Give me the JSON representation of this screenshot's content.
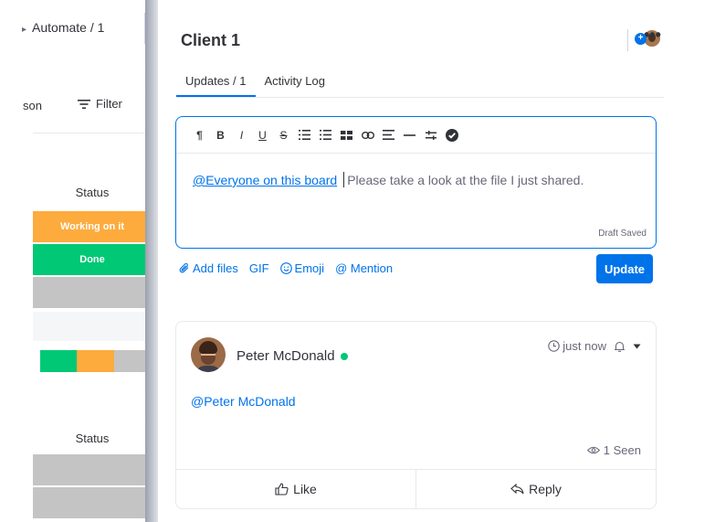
{
  "board": {
    "automate_label": "Automate / 1",
    "person_label": "son",
    "filter_label": "Filter",
    "status_header_1": "Status",
    "status_header_2": "Status",
    "cells": [
      "Working on it",
      "Done"
    ],
    "colors": {
      "working": "#fdab3d",
      "done": "#00c875",
      "empty": "#c4c4c4"
    },
    "progress": [
      {
        "status": "Done",
        "fraction": 0.33,
        "color": "#00c875"
      },
      {
        "status": "Working on it",
        "fraction": 0.33,
        "color": "#fdab3d"
      },
      {
        "status": "empty",
        "fraction": 0.34,
        "color": "#c4c4c4"
      }
    ]
  },
  "panel": {
    "title": "Client 1",
    "more_label": "•••",
    "tabs": [
      {
        "label": "Updates / 1",
        "active": true
      },
      {
        "label": "Activity Log",
        "active": false
      }
    ],
    "editor": {
      "toolbar": [
        "paragraph-icon",
        "bold-icon",
        "italic-icon",
        "underline-icon",
        "strikethrough-icon",
        "bulleted-list-icon",
        "numbered-list-icon",
        "checklist-icon",
        "link-icon",
        "align-icon",
        "divider-icon",
        "code-icon",
        "check-circle-icon"
      ],
      "toolbar_labels": {
        "paragraph": "¶",
        "bold": "B",
        "italic": "I",
        "underline": "U",
        "strike": "S"
      },
      "mention": "@Everyone on this board",
      "text": "Please take a look at the file I just shared.",
      "draft_status": "Draft Saved"
    },
    "actions": {
      "add_files": "Add files",
      "gif": "GIF",
      "emoji": "Emoji",
      "mention": "@ Mention"
    },
    "update_button": "Update",
    "post": {
      "author": "Peter McDonald",
      "time": "just now",
      "body": "@Peter McDonald",
      "seen": "1 Seen",
      "like_label": "Like",
      "reply_label": "Reply"
    },
    "accent_color": "#0073ea"
  }
}
